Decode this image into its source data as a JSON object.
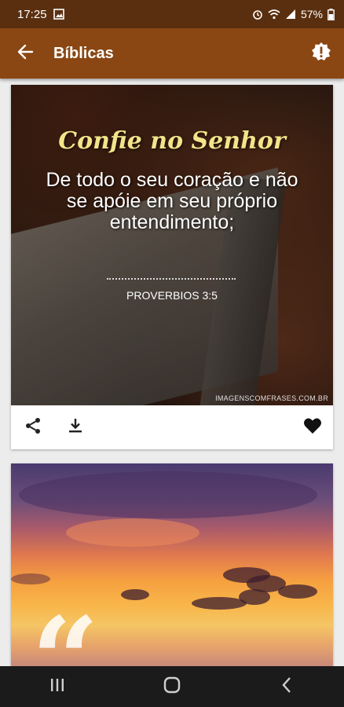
{
  "status_bar": {
    "time": "17:25",
    "battery": "57%",
    "left_icons": [
      "image-icon"
    ],
    "right_icons": [
      "alarm-icon",
      "wifi-icon",
      "signal-icon",
      "battery-icon"
    ]
  },
  "app_bar": {
    "title": "Bíblicas",
    "back_icon": "arrow-back-icon",
    "action_icon": "alert-badge-icon",
    "color": "#8a4713",
    "status_color": "#5a2f0f"
  },
  "cards": [
    {
      "image": {
        "title": "Confie no Senhor",
        "text": "De todo o seu coração e não se apóie em seu próprio entendimento;",
        "reference": "PROVERBIOS 3:5",
        "watermark": "IMAGENSCOMFRASES.COM.BR"
      },
      "actions": [
        "share-icon",
        "download-icon",
        "heart-icon"
      ]
    },
    {
      "image": {
        "quote_mark": "“"
      }
    }
  ],
  "nav_bar": {
    "buttons": [
      "recents-icon",
      "home-icon",
      "back-icon"
    ]
  }
}
